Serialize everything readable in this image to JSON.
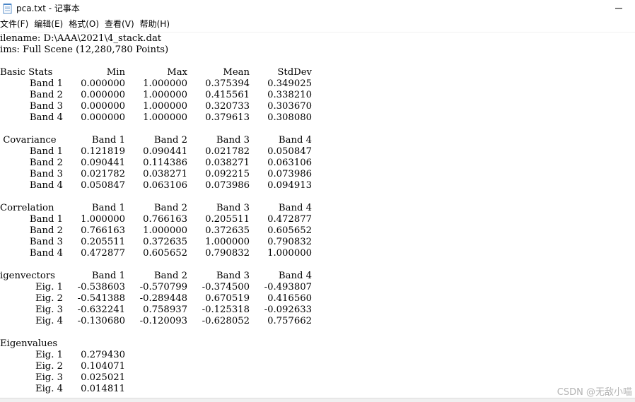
{
  "window": {
    "title": "pca.txt - 记事本",
    "icon": "notepad-icon"
  },
  "menu": [
    {
      "label": "文件(F)"
    },
    {
      "label": "编辑(E)"
    },
    {
      "label": "格式(O)"
    },
    {
      "label": "查看(V)"
    },
    {
      "label": "帮助(H)"
    }
  ],
  "document": {
    "header": [
      "ilename: D:\\AAA\\2021\\4_stack.dat",
      "ims: Full Scene (12,280,780 Points)"
    ],
    "sections": [
      {
        "header": [
          "Basic Stats",
          "Min",
          "Max",
          "Mean",
          "StdDev"
        ],
        "rows": [
          [
            "Band 1",
            "0.000000",
            "1.000000",
            "0.375394",
            "0.349025"
          ],
          [
            "Band 2",
            "0.000000",
            "1.000000",
            "0.415561",
            "0.338210"
          ],
          [
            "Band 3",
            "0.000000",
            "1.000000",
            "0.320733",
            "0.303670"
          ],
          [
            "Band 4",
            "0.000000",
            "1.000000",
            "0.379613",
            "0.308080"
          ]
        ]
      },
      {
        "header": [
          " Covariance",
          "Band 1",
          "Band 2",
          "Band 3",
          "Band 4"
        ],
        "rows": [
          [
            "Band 1",
            "0.121819",
            "0.090441",
            "0.021782",
            "0.050847"
          ],
          [
            "Band 2",
            "0.090441",
            "0.114386",
            "0.038271",
            "0.063106"
          ],
          [
            "Band 3",
            "0.021782",
            "0.038271",
            "0.092215",
            "0.073986"
          ],
          [
            "Band 4",
            "0.050847",
            "0.063106",
            "0.073986",
            "0.094913"
          ]
        ]
      },
      {
        "header": [
          "Correlation",
          "Band 1",
          "Band 2",
          "Band 3",
          "Band 4"
        ],
        "rows": [
          [
            "Band 1",
            "1.000000",
            "0.766163",
            "0.205511",
            "0.472877"
          ],
          [
            "Band 2",
            "0.766163",
            "1.000000",
            "0.372635",
            "0.605652"
          ],
          [
            "Band 3",
            "0.205511",
            "0.372635",
            "1.000000",
            "0.790832"
          ],
          [
            "Band 4",
            "0.472877",
            "0.605652",
            "0.790832",
            "1.000000"
          ]
        ]
      },
      {
        "header": [
          "igenvectors",
          "Band 1",
          "Band 2",
          "Band 3",
          "Band 4"
        ],
        "rows": [
          [
            "Eig. 1",
            "-0.538603",
            "-0.570799",
            "-0.374500",
            "-0.493807"
          ],
          [
            "Eig. 2",
            "-0.541388",
            "-0.289448",
            "0.670519",
            "0.416560"
          ],
          [
            "Eig. 3",
            "-0.632241",
            "0.758937",
            "-0.125318",
            "-0.092633"
          ],
          [
            "Eig. 4",
            "-0.130680",
            "-0.120093",
            "-0.628052",
            "0.757662"
          ]
        ]
      },
      {
        "header": [
          "Eigenvalues"
        ],
        "rows": [
          [
            "Eig. 1",
            "0.279430"
          ],
          [
            "Eig. 2",
            "0.104071"
          ],
          [
            "Eig. 3",
            "0.025021"
          ],
          [
            "Eig. 4",
            "0.014811"
          ]
        ]
      }
    ]
  },
  "watermark": "CSDN @无敌小喵"
}
